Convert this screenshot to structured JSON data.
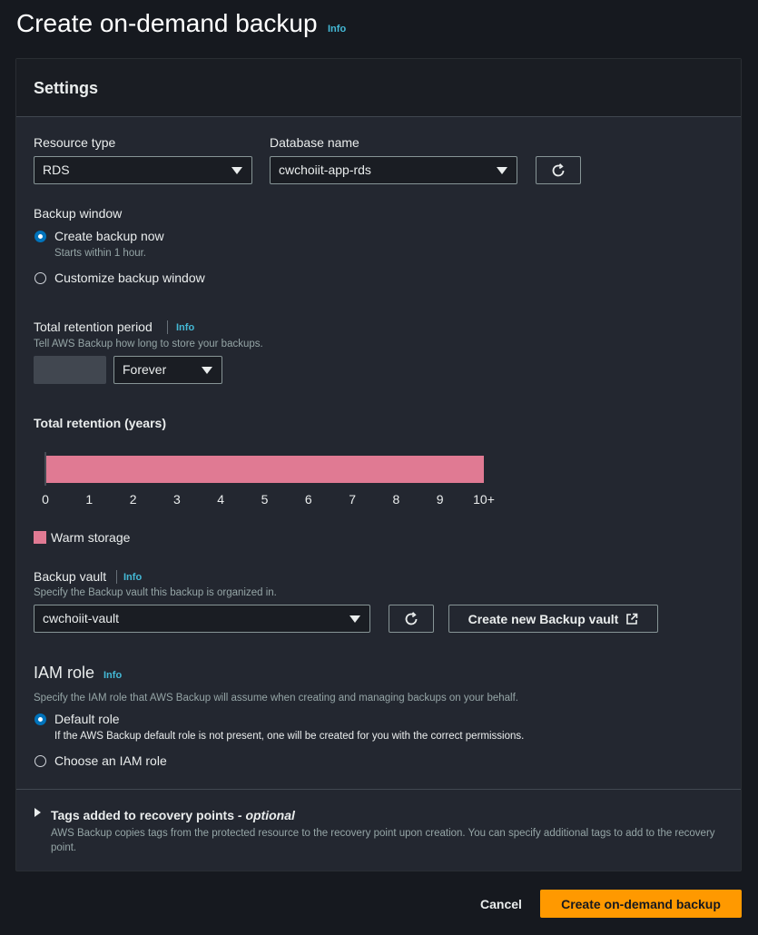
{
  "page": {
    "title": "Create on-demand backup",
    "info": "Info"
  },
  "settings": {
    "header": "Settings",
    "resource_type": {
      "label": "Resource type",
      "value": "RDS"
    },
    "database_name": {
      "label": "Database name",
      "value": "cwchoiit-app-rds"
    },
    "backup_window": {
      "label": "Backup window",
      "options": [
        {
          "label": "Create backup now",
          "desc": "Starts within 1 hour.",
          "selected": true
        },
        {
          "label": "Customize backup window",
          "selected": false
        }
      ]
    },
    "retention": {
      "label": "Total retention period",
      "info": "Info",
      "desc": "Tell AWS Backup how long to store your backups.",
      "value": "",
      "unit": "Forever"
    },
    "retention_chart": {
      "title": "Total retention (years)",
      "legend": "Warm storage"
    },
    "backup_vault": {
      "label": "Backup vault",
      "info": "Info",
      "desc": "Specify the Backup vault this backup is organized in.",
      "value": "cwchoiit-vault",
      "create_button": "Create new Backup vault"
    },
    "iam_role": {
      "title": "IAM role",
      "info": "Info",
      "desc": "Specify the IAM role that AWS Backup will assume when creating and managing backups on your behalf.",
      "options": [
        {
          "label": "Default role",
          "desc": "If the AWS Backup default role is not present, one will be created for you with the correct permissions.",
          "selected": true
        },
        {
          "label": "Choose an IAM role",
          "selected": false
        }
      ]
    },
    "tags": {
      "label": "Tags added to recovery points",
      "optional": "- optional",
      "desc": "AWS Backup copies tags from the protected resource to the recovery point upon creation. You can specify additional tags to add to the recovery point."
    }
  },
  "chart_data": {
    "type": "bar",
    "orientation": "horizontal",
    "title": "Total retention (years)",
    "categories": [
      "Warm storage"
    ],
    "series": [
      {
        "name": "Warm storage",
        "values": [
          10
        ]
      }
    ],
    "xticks": [
      "0",
      "1",
      "2",
      "3",
      "4",
      "5",
      "6",
      "7",
      "8",
      "9",
      "10+"
    ],
    "xlim": [
      0,
      10
    ],
    "legend": "bottom-left",
    "colors": {
      "warm": "#e07a93"
    }
  },
  "footer": {
    "cancel": "Cancel",
    "submit": "Create on-demand backup"
  },
  "colors": {
    "accent": "#ff9900",
    "link": "#44b9d6",
    "radio": "#0073bb"
  }
}
